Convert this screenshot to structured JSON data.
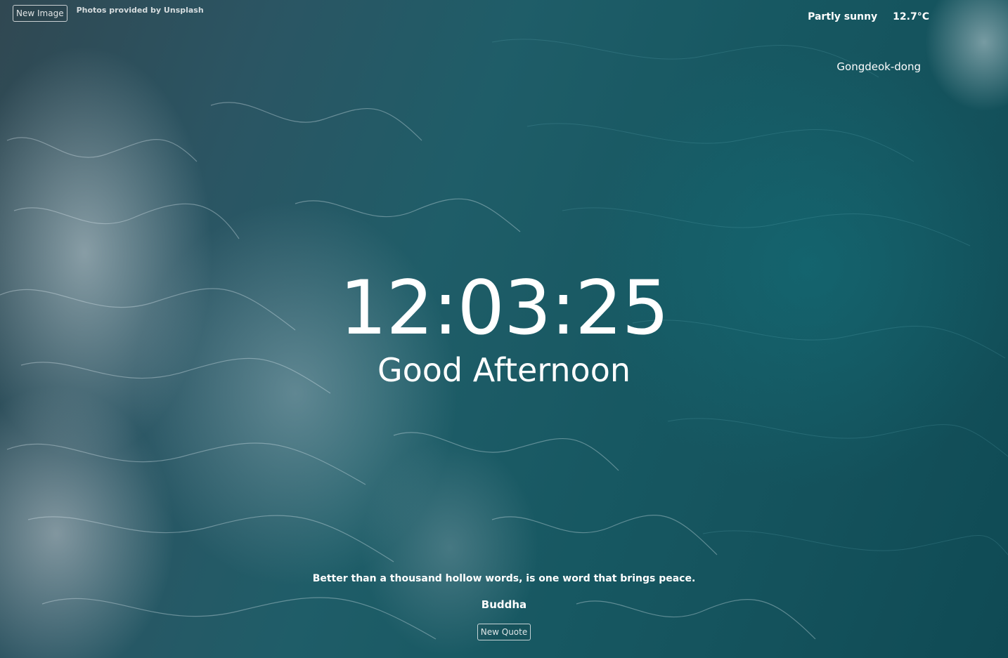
{
  "controls": {
    "new_image_label": "New Image",
    "credit": "Photos provided by Unsplash"
  },
  "weather": {
    "condition": "Partly sunny",
    "temperature": "12.7°C",
    "location": "Gongdeok-dong"
  },
  "main": {
    "time": "12:03:25",
    "greeting": "Good Afternoon"
  },
  "quote": {
    "text": "Better than a thousand hollow words, is one word that brings peace.",
    "author": "Buddha",
    "new_quote_label": "New Quote"
  },
  "background": {
    "primary_color": "#175862",
    "foam_color": "#d2dce1"
  }
}
